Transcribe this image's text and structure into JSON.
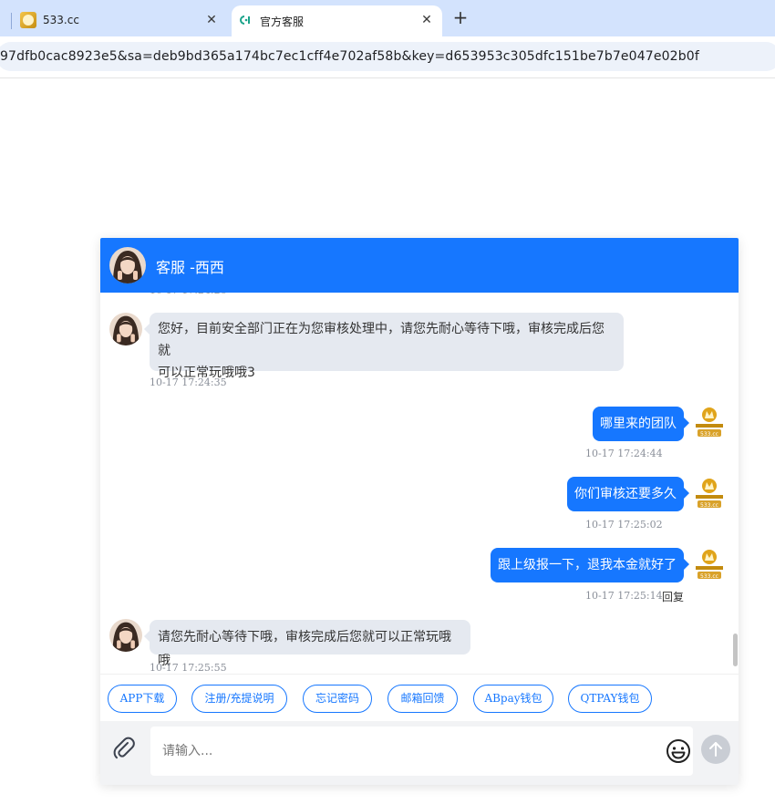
{
  "browser": {
    "tabs": [
      {
        "title": "533.cc",
        "icon": "site-logo-icon"
      },
      {
        "title": "官方客服",
        "icon": "chat-link-icon",
        "active": true
      }
    ],
    "close_glyph": "✕",
    "new_tab_glyph": "+",
    "url": "97dfb0cac8923e5&sa=deb9bd365a174bc7ec1cff4e702af58b&key=d653953c305dfc151be7b7e047e02b0f"
  },
  "chat": {
    "title": "客服 -西西",
    "header_color": "#1677ff",
    "messages": [
      {
        "side": "agent",
        "text_line1": "您好，目前安全部门正在为您审核处理中，请您先耐心等待下哦，审核完成后您就",
        "text_line2": "可以正常玩哦哦3",
        "time": "10-17 17:24:35"
      },
      {
        "side": "user",
        "text": "哪里来的团队",
        "time": "10-17 17:24:44"
      },
      {
        "side": "user",
        "text": "你们审核还要多久",
        "time": "10-17 17:25:02"
      },
      {
        "side": "user",
        "text": "跟上级报一下，退我本金就好了",
        "time": "10-17 17:25:14",
        "action": "回复"
      },
      {
        "side": "agent",
        "text": "请您先耐心等待下哦，审核完成后您就可以正常玩哦哦",
        "time": "10-17 17:25:55"
      }
    ],
    "quick_buttons": [
      "APP下载",
      "注册/充提说明",
      "忘记密码",
      "邮箱回馈",
      "ABpay钱包",
      "QTPAY钱包"
    ],
    "input_placeholder": "请输入...",
    "user_avatar_text": "533.cc"
  }
}
